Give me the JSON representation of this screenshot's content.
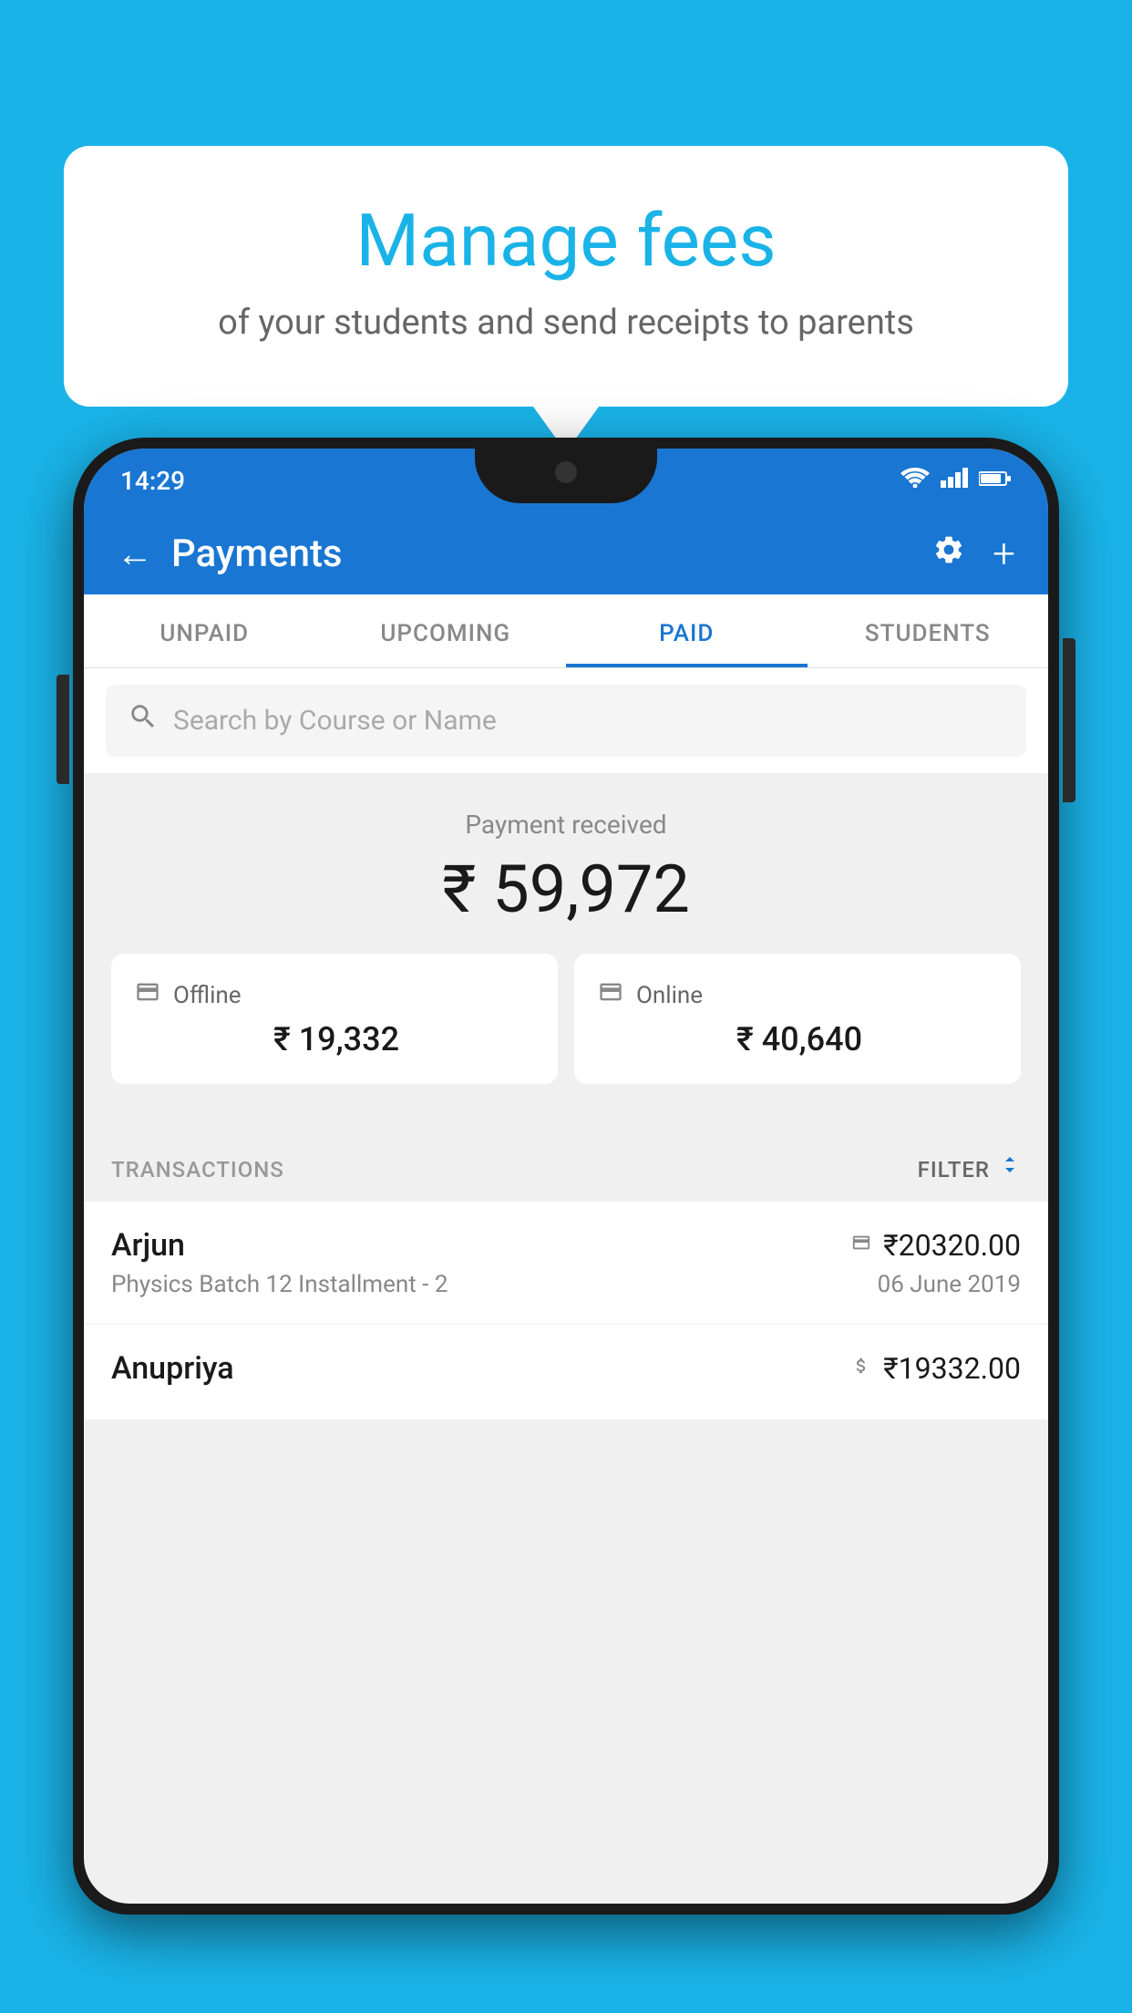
{
  "background_color": "#1ab3e8",
  "speech_bubble": {
    "title": "Manage fees",
    "subtitle": "of your students and send receipts to parents"
  },
  "status_bar": {
    "time": "14:29",
    "icons": [
      "wifi",
      "signal",
      "battery"
    ]
  },
  "app_header": {
    "title": "Payments",
    "back_label": "←",
    "settings_label": "⚙",
    "add_label": "+"
  },
  "tabs": [
    {
      "label": "UNPAID",
      "active": false
    },
    {
      "label": "UPCOMING",
      "active": false
    },
    {
      "label": "PAID",
      "active": true
    },
    {
      "label": "STUDENTS",
      "active": false
    }
  ],
  "search": {
    "placeholder": "Search by Course or Name"
  },
  "payment_received": {
    "label": "Payment received",
    "amount": "₹ 59,972",
    "offline": {
      "icon": "💳",
      "label": "Offline",
      "amount": "₹ 19,332"
    },
    "online": {
      "icon": "💳",
      "label": "Online",
      "amount": "₹ 40,640"
    }
  },
  "transactions": {
    "header_label": "TRANSACTIONS",
    "filter_label": "FILTER",
    "rows": [
      {
        "name": "Arjun",
        "amount": "₹20320.00",
        "course": "Physics Batch 12 Installment - 2",
        "date": "06 June 2019",
        "payment_type": "online"
      },
      {
        "name": "Anupriya",
        "amount": "₹19332.00",
        "course": "",
        "date": "",
        "payment_type": "offline"
      }
    ]
  }
}
